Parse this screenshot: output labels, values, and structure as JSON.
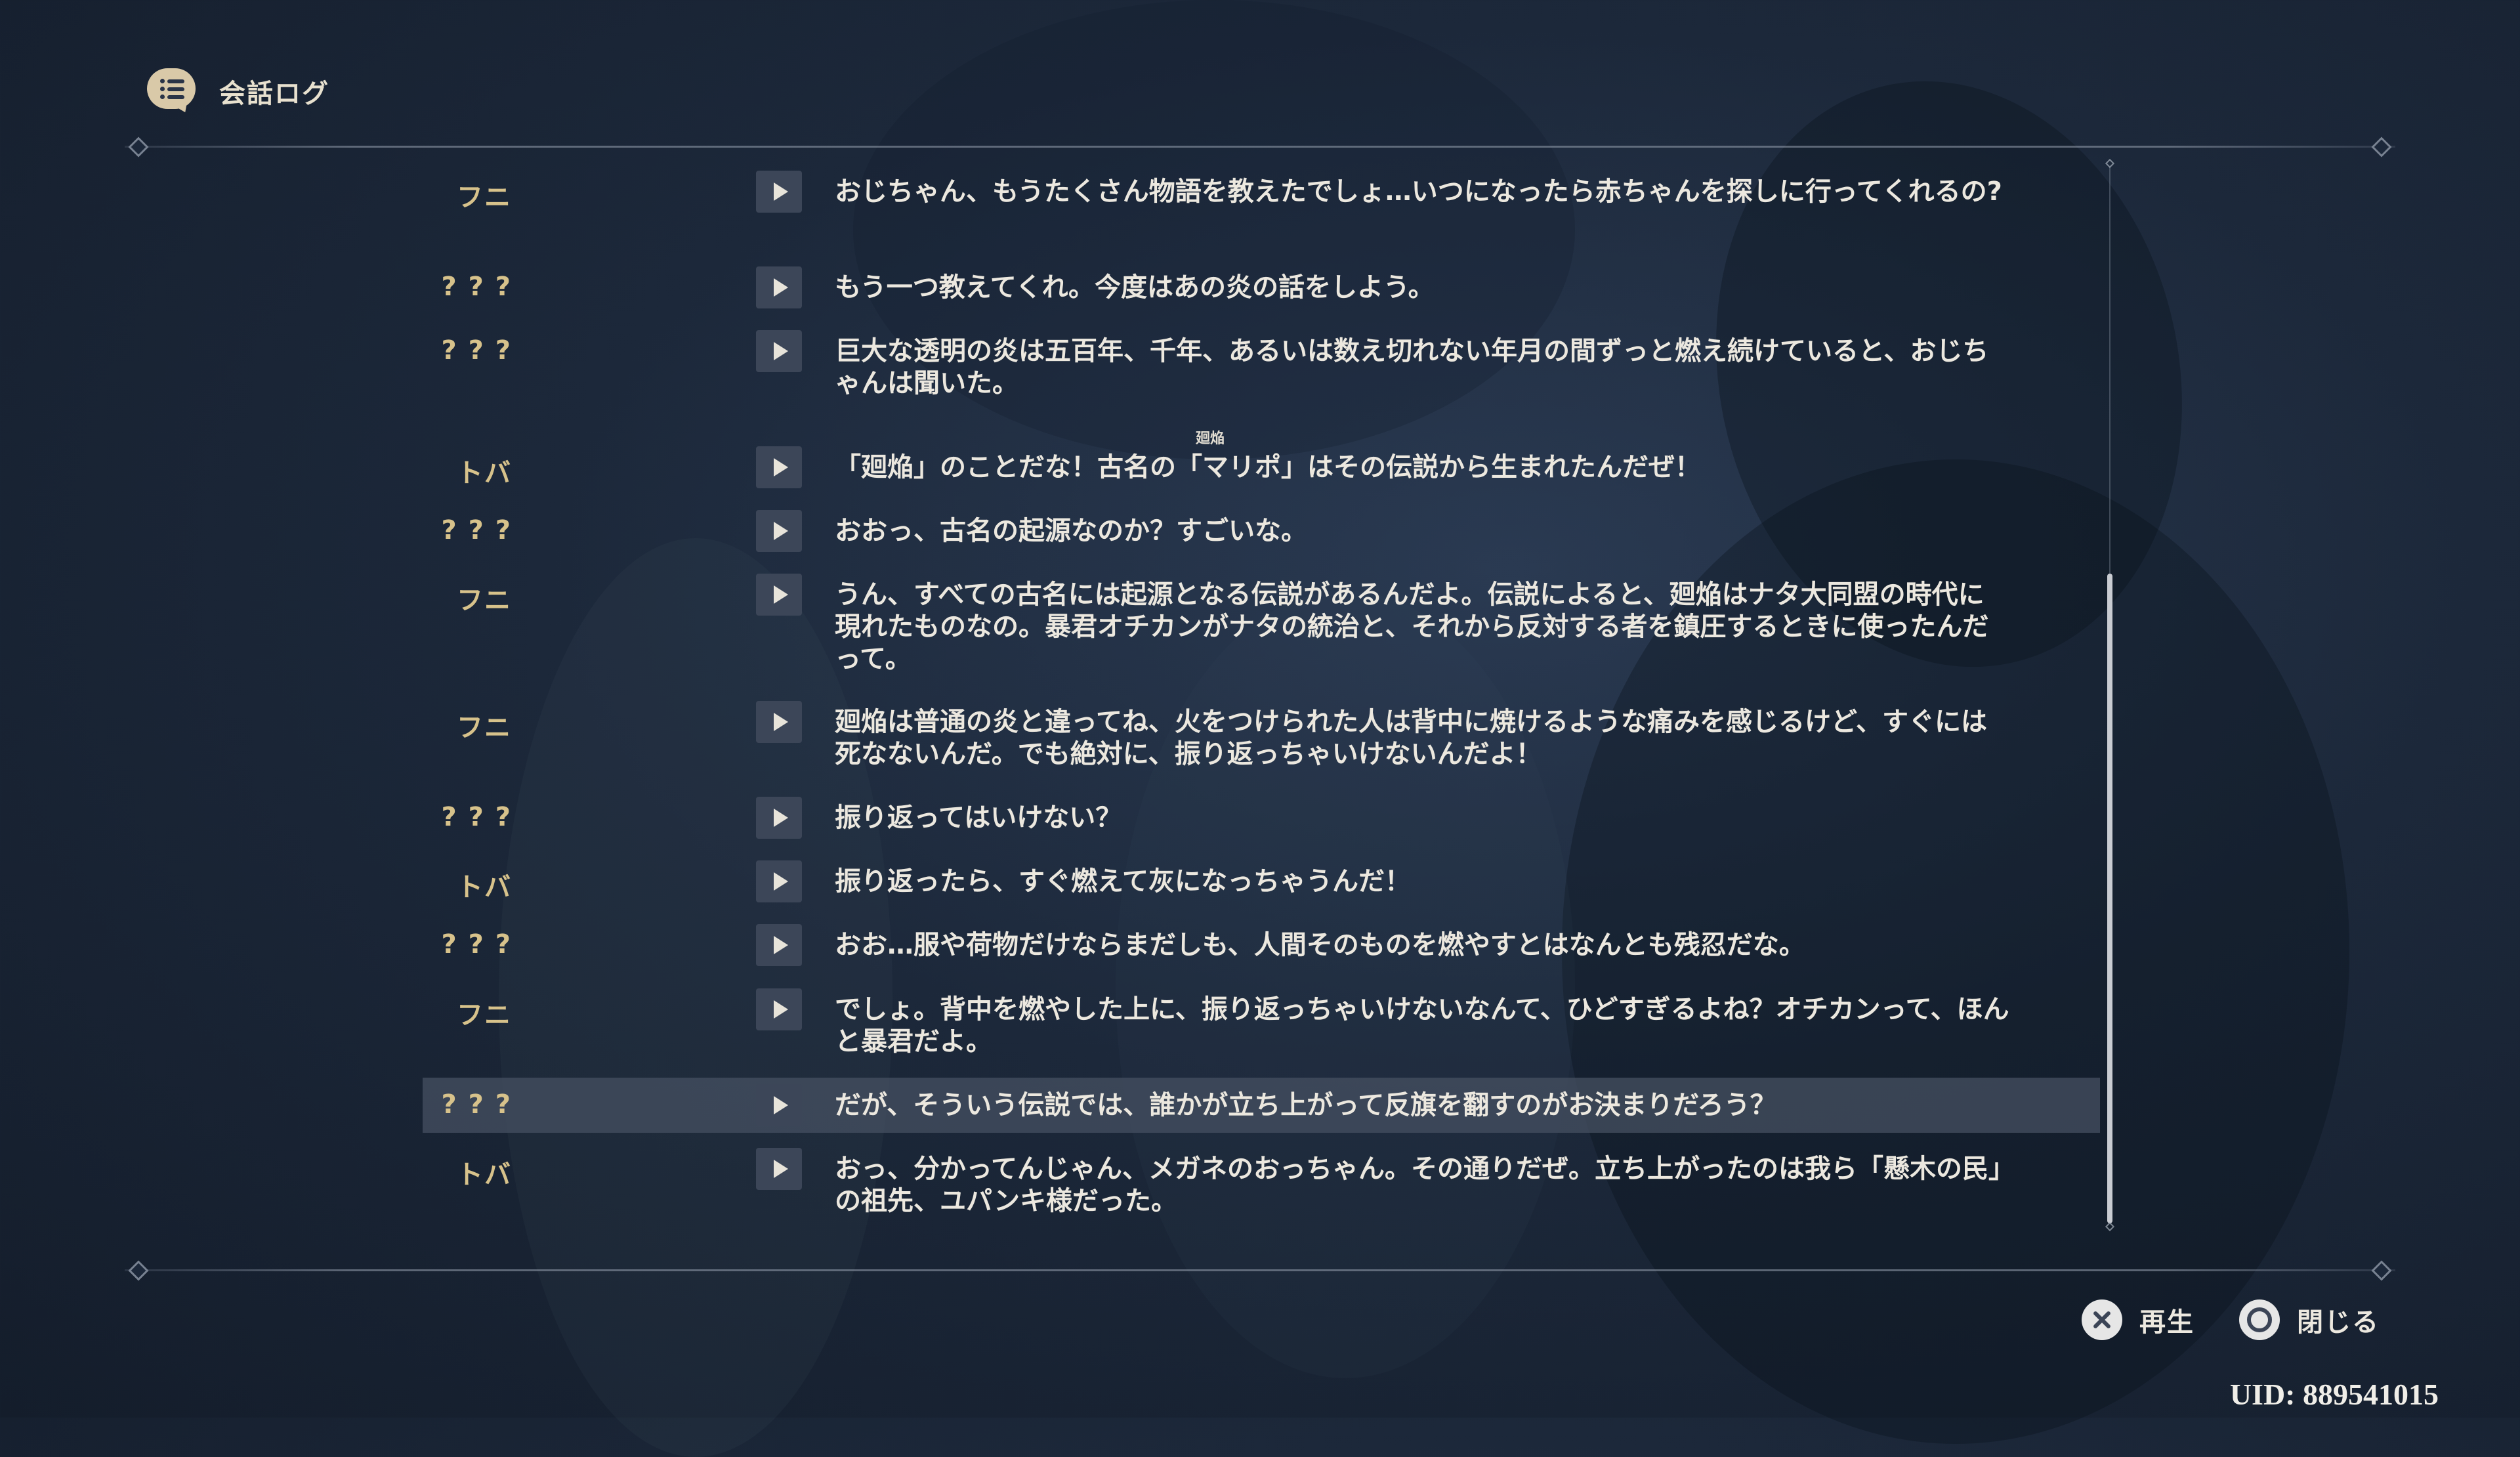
{
  "header": {
    "title": "会話ログ"
  },
  "dialogue": [
    {
      "speaker": "フニ",
      "text": "おじちゃん、もうたくさん物語を教えたでしょ…いつになったら赤ちゃんを探しに行ってくれるの?"
    },
    {
      "speaker": "? ? ?",
      "text": "もう一つ教えてくれ。今度はあの炎の話をしよう。"
    },
    {
      "speaker": "? ? ?",
      "text": "巨大な透明の炎は五百年、千年、あるいは数え切れない年月の間ずっと燃え続けていると、おじちゃんは聞いた。"
    },
    {
      "speaker": "トバ",
      "text": "「廻焔」のことだな！古名の「マリポ」はその伝説から生まれたんだぜ！",
      "ruby": "廻焔"
    },
    {
      "speaker": "? ? ?",
      "text": "おおっ、古名の起源なのか？すごいな。"
    },
    {
      "speaker": "フニ",
      "text": "うん、すべての古名には起源となる伝説があるんだよ。伝説によると、廻焔はナタ大同盟の時代に現れたものなの。暴君オチカンがナタの統治と、それから反対する者を鎮圧するときに使ったんだって。"
    },
    {
      "speaker": "フニ",
      "text": "廻焔は普通の炎と違ってね、火をつけられた人は背中に焼けるような痛みを感じるけど、すぐには死なないんだ。でも絶対に、振り返っちゃいけないんだよ！"
    },
    {
      "speaker": "? ? ?",
      "text": "振り返ってはいけない？"
    },
    {
      "speaker": "トバ",
      "text": "振り返ったら、すぐ燃えて灰になっちゃうんだ！"
    },
    {
      "speaker": "? ? ?",
      "text": "おお…服や荷物だけならまだしも、人間そのものを燃やすとはなんとも残忍だな。"
    },
    {
      "speaker": "フニ",
      "text": "でしょ。背中を燃やした上に、振り返っちゃいけないなんて、ひどすぎるよね？オチカンって、ほんと暴君だよ。"
    },
    {
      "speaker": "? ? ?",
      "text": "だが、そういう伝説では、誰かが立ち上がって反旗を翻すのがお決まりだろう？",
      "selected": true
    },
    {
      "speaker": "トバ",
      "text": "おっ、分かってんじゃん、メガネのおっちゃん。その通りだぜ。立ち上がったのは我ら「懸木の民」の祖先、ユパンキ様だった。"
    }
  ],
  "controls": {
    "play_label": "再生",
    "close_label": "閉じる"
  },
  "uid": "UID: 889541015"
}
